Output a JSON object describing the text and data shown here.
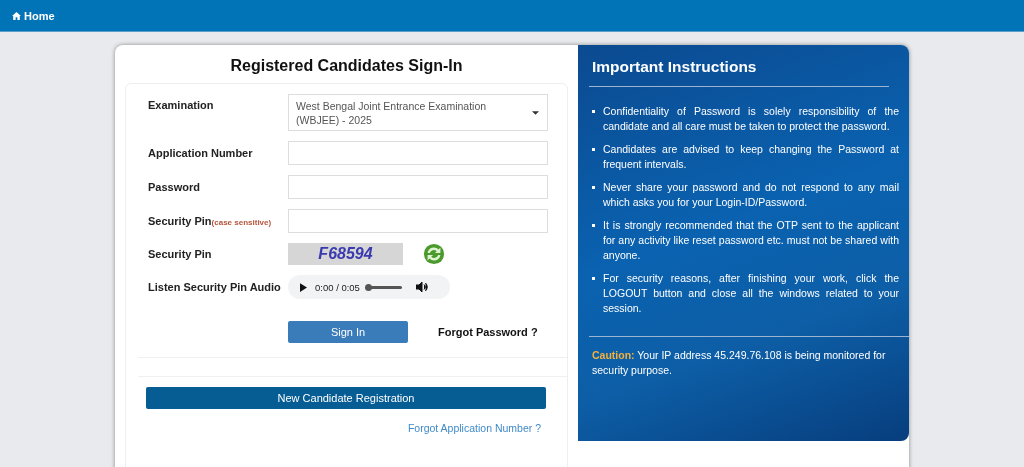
{
  "top_bar": {
    "home_link": "Home"
  },
  "sign_in": {
    "title": "Registered Candidates Sign-In",
    "fields": [
      {
        "kind": "select",
        "label": "Examination",
        "value": "West Bengal Joint Entrance Examination (WBJEE) - 2025"
      },
      {
        "kind": "input",
        "label": "Application Number"
      },
      {
        "kind": "input",
        "label": "Password"
      },
      {
        "kind": "input",
        "label": "Security Pin",
        "note": "(case sensitive)"
      },
      {
        "kind": "captcha",
        "label": "Security Pin",
        "captcha_text": "F68594"
      },
      {
        "kind": "audio",
        "label": "Listen Security Pin Audio",
        "time": "0:00 / 0:05",
        "level": 0
      }
    ],
    "sign_in_button": "Sign In",
    "forgot_password": "Forgot Password ?",
    "register_button": "New Candidate Registration",
    "forgot_application_number": "Forgot Application Number ?"
  },
  "instructions": {
    "title": "Important Instructions",
    "items": [
      "Confidentiality of Password is solely responsibility of the candidate and all care must be taken to protect the password.",
      "Candidates are advised to keep changing the Password at frequent intervals.",
      "Never share your password and do not respond to any mail which asks you for your Login-ID/Password.",
      "It is strongly recommended that the OTP sent to the applicant for any activity like reset password etc. must not be shared with anyone.",
      "For security reasons, after finishing your work, click the LOGOUT button and close all the windows related to your session."
    ],
    "caution_label": "Caution:",
    "caution_text": "Your IP address 45.249.76.108 is being monitored for security purpose."
  }
}
